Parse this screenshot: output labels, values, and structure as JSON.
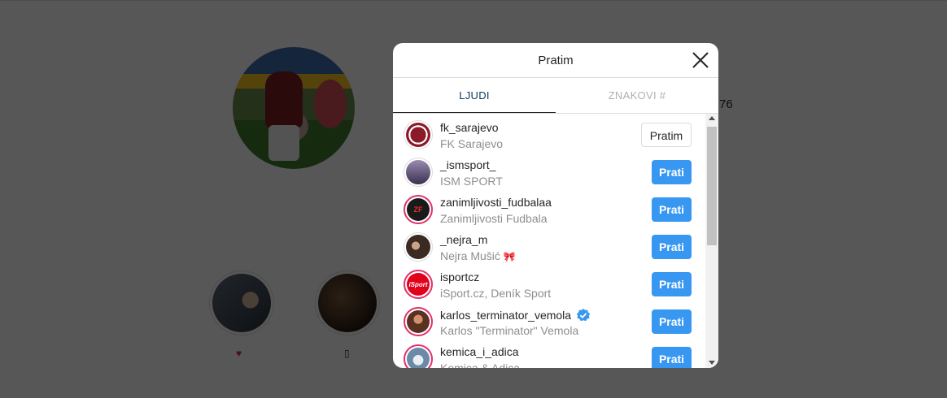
{
  "background": {
    "count_fragment": "76",
    "highlights": [
      {
        "icon": "heart-icon",
        "label": "♥"
      },
      {
        "icon": "unknown-glyph-icon",
        "label": "▯"
      }
    ]
  },
  "modal": {
    "title": "Pratim",
    "close_icon": "close-icon",
    "tabs": [
      {
        "label": "LJUDI",
        "active": true
      },
      {
        "label": "ZNAKOVI #",
        "active": false
      }
    ],
    "accounts": [
      {
        "username": "fk_sarajevo",
        "full_name": "FK Sarajevo",
        "button": "Pratim",
        "following": true,
        "verified": false
      },
      {
        "username": "_ismsport_",
        "full_name": "ISM SPORT",
        "button": "Prati",
        "following": false,
        "verified": false
      },
      {
        "username": "zanimljivosti_fudbalaa",
        "full_name": "Zanimljivosti Fudbala",
        "button": "Prati",
        "following": false,
        "verified": false
      },
      {
        "username": "_nejra_m",
        "full_name": "Nejra Mušić",
        "full_name_emoji": "🎀",
        "button": "Prati",
        "following": false,
        "verified": false
      },
      {
        "username": "isportcz",
        "full_name": "iSport.cz, Deník Sport",
        "button": "Prati",
        "following": false,
        "verified": false
      },
      {
        "username": "karlos_terminator_vemola",
        "full_name": "Karlos \"Terminator\" Vemola",
        "button": "Prati",
        "following": false,
        "verified": true
      },
      {
        "username": "kemica_i_adica",
        "full_name": "Kemica & Adica",
        "button": "Prati",
        "following": false,
        "verified": false
      }
    ],
    "colors": {
      "accent": "#3897f0",
      "active_tab": "#0d3c61",
      "story_ring": "#e1306c"
    }
  }
}
